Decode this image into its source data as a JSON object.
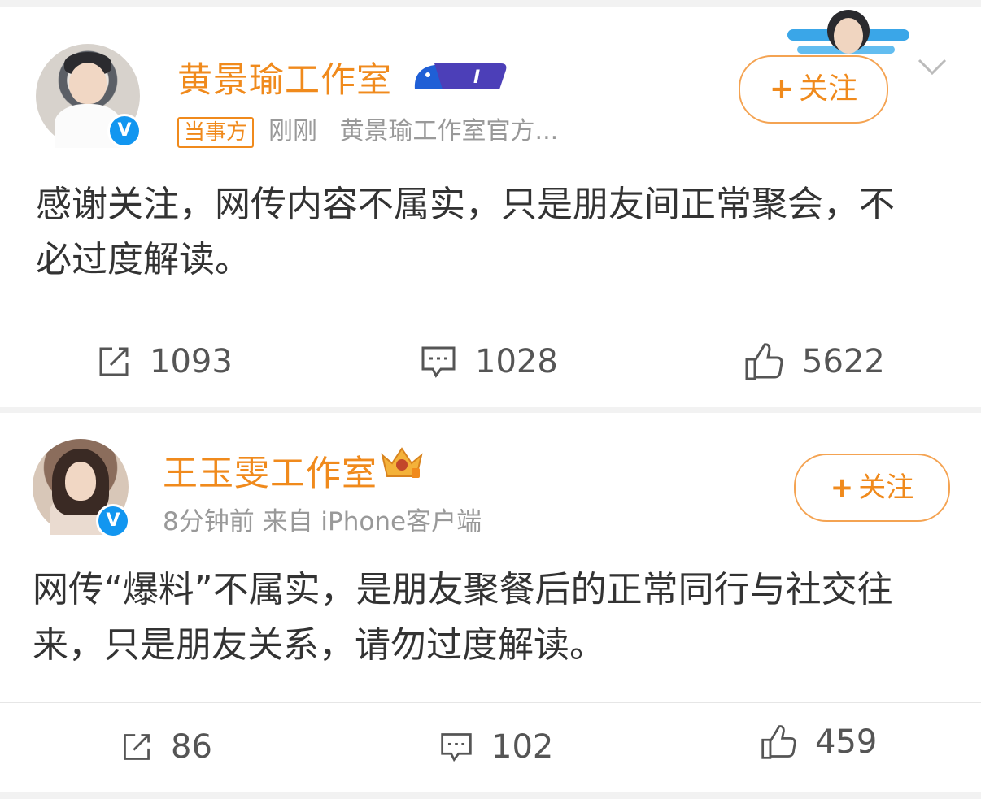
{
  "posts": [
    {
      "author": "黄景瑜工作室",
      "tag": "当事方",
      "time": "刚刚",
      "source": "黄景瑜工作室官方...",
      "follow_label": "关注",
      "content": "感谢关注，网传内容不属实，只是朋友间正常聚会，不必过度解读。",
      "reposts": "1093",
      "comments": "1028",
      "likes": "5622"
    },
    {
      "author": "王玉雯工作室",
      "time_source": "8分钟前 来自 iPhone客户端",
      "follow_label": "关注",
      "content": "网传“爆料”不属实，是朋友聚餐后的正常同行与社交往来，只是朋友关系，请勿过度解读。",
      "reposts": "86",
      "comments": "102",
      "likes": "459"
    }
  ],
  "icons": {
    "verified": "verified-v-icon",
    "repost": "share-edit-icon",
    "comment": "comment-icon",
    "like": "thumbs-up-icon",
    "menu": "chevron-down-icon"
  },
  "colors": {
    "accent": "#f08a1c",
    "verified": "#1296f0",
    "text": "#333333",
    "meta": "#999999"
  }
}
